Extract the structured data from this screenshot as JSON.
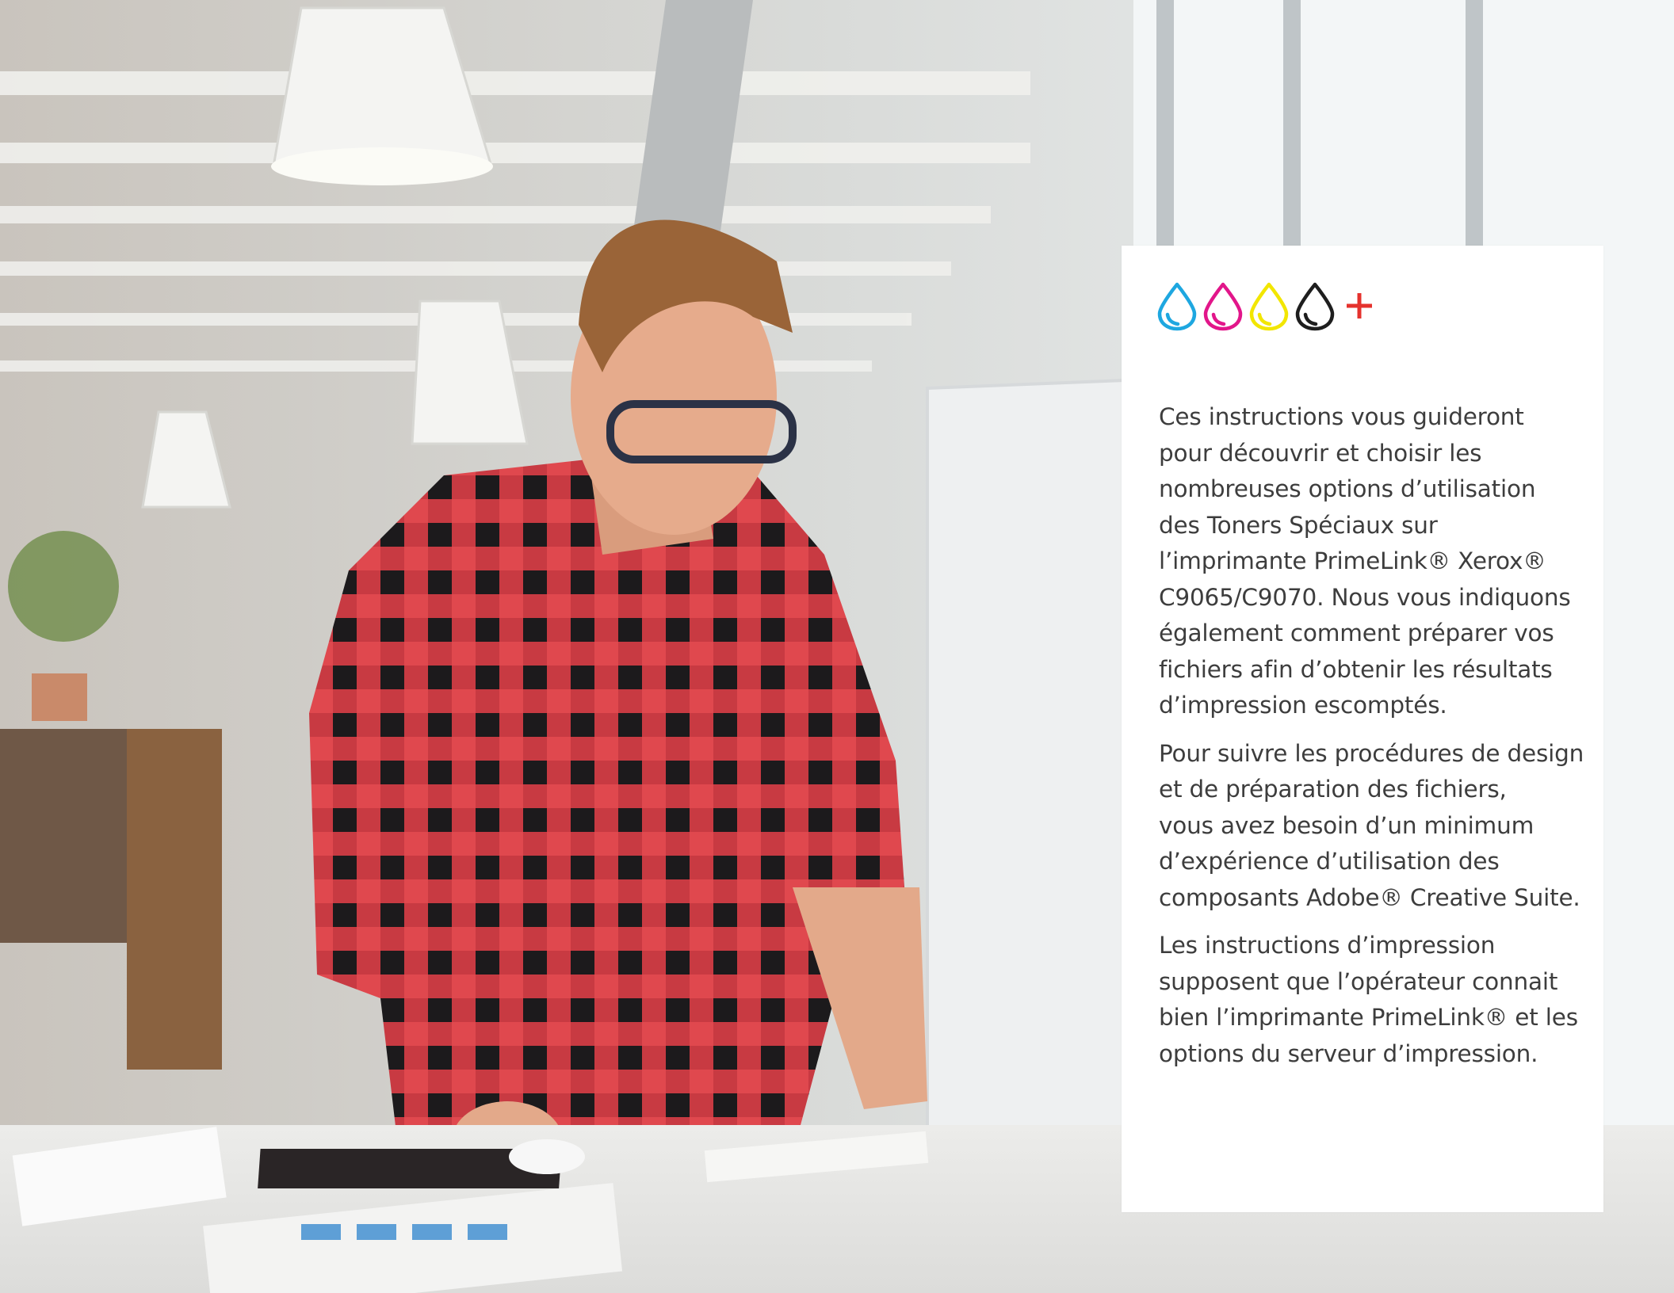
{
  "card": {
    "paragraphs": [
      "Ces instructions vous guideront\npour découvrir et choisir les\nnombreuses options d’utilisation\ndes Toners Spéciaux sur\nl’imprimante PrimeLink® Xerox®\nC9065/C9070. Nous vous indiquons\négalement comment préparer vos\nfichiers afin d’obtenir les résultats\nd’impression escomptés.",
      "Pour suivre les procédures de design\net de préparation des fichiers,\nvous avez besoin d’un minimum\nd’expérience d’utilisation des\ncomposants Adobe® Creative Suite.",
      "Les instructions d’impression\nsupposent que l’opérateur connait\nbien l’imprimante PrimeLink® et les\noptions du serveur d’impression."
    ],
    "icons": [
      "cyan-drop-icon",
      "magenta-drop-icon",
      "yellow-drop-icon",
      "black-drop-icon",
      "plus-icon"
    ]
  },
  "colors": {
    "cyan": "#1ea7e0",
    "magenta": "#e2168a",
    "yellow": "#f2e600",
    "black": "#1e1e1e",
    "plus": "#e5322d",
    "text": "#3d3d3d",
    "card": "#ffffff"
  }
}
